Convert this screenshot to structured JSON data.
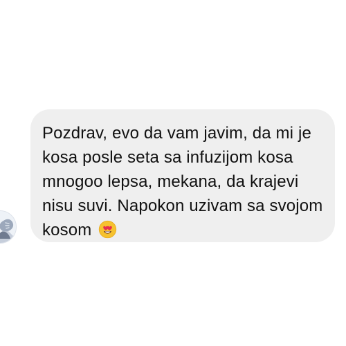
{
  "conversation": {
    "sender_avatar": {
      "icon": "profile-photo-icon"
    },
    "message": {
      "text": "Pozdrav, evo da vam javim, da mi je kosa posle seta sa infuzijom kosa mnogoo lepsa, mekana, da krajevi nisu suvi. Napokon uzivam sa svojom kosom",
      "emoji": "heart-eyes-emoji-icon",
      "bubble_color": "#efefef",
      "text_color": "#111111"
    }
  }
}
